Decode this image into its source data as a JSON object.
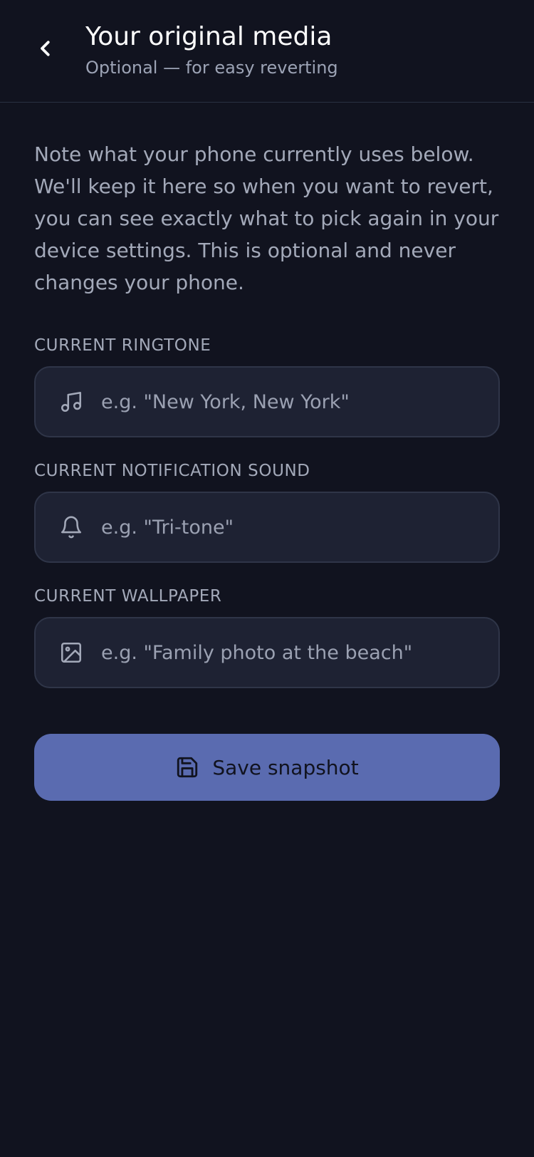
{
  "header": {
    "back_icon": "chevron-left-icon",
    "title": "Your original media",
    "subtitle": "Optional — for easy reverting"
  },
  "intro": "Note what your phone currently uses below. We'll keep it here so when you want to revert, you can see exactly what to pick again in your device settings. This is optional and never changes your phone.",
  "fields": {
    "ringtone": {
      "label": "CURRENT RINGTONE",
      "placeholder": "e.g. \"New York, New York\"",
      "value": "",
      "icon": "music-note-icon"
    },
    "notification": {
      "label": "CURRENT NOTIFICATION SOUND",
      "placeholder": "e.g. \"Tri-tone\"",
      "value": "",
      "icon": "bell-icon"
    },
    "wallpaper": {
      "label": "CURRENT WALLPAPER",
      "placeholder": "e.g. \"Family photo at the beach\"",
      "value": "",
      "icon": "image-icon"
    }
  },
  "save_button": {
    "label": "Save snapshot",
    "icon": "save-icon",
    "color": "#5a6bb0"
  },
  "colors": {
    "background": "#11131f",
    "field_background": "#1e2233",
    "muted_text": "#a3a9b9"
  }
}
